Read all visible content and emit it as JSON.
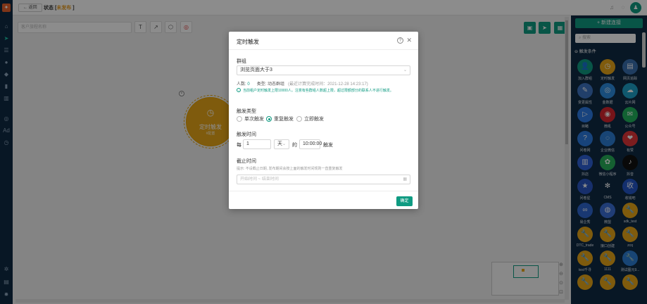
{
  "header": {
    "back_label": "← 返回",
    "status_prefix": "状态 [",
    "status_value": "未发布",
    "status_suffix": " ]"
  },
  "canvas": {
    "name_placeholder": "客户旅程名称",
    "node": {
      "title": "定时触发",
      "subtitle": "#配置"
    }
  },
  "right_panel": {
    "new_connection": "+ 新建连接",
    "search_placeholder": "搜索",
    "section_title": "触发条件",
    "items": [
      {
        "label": "加入群组",
        "color": "#0f9b82",
        "glyph": "👤"
      },
      {
        "label": "定时触发",
        "color": "#e8a619",
        "glyph": "◷"
      },
      {
        "label": "网页追踪",
        "color": "#3a6fb0",
        "glyph": "▤"
      },
      {
        "label": "变更属性",
        "color": "#3c73c2",
        "glyph": "✎"
      },
      {
        "label": "金数据",
        "color": "#2d8de0",
        "glyph": "◎"
      },
      {
        "label": "云片网",
        "color": "#1ea0c8",
        "glyph": "☁"
      },
      {
        "label": "目睹",
        "color": "#2c7be5",
        "glyph": "▷"
      },
      {
        "label": "微吼",
        "color": "#d8262f",
        "glyph": "◉"
      },
      {
        "label": "公众号",
        "color": "#22b35e",
        "glyph": "✉"
      },
      {
        "label": "问卷网",
        "color": "#2a7be0",
        "glyph": "?"
      },
      {
        "label": "企业微信",
        "color": "#2d7fd6",
        "glyph": "◌"
      },
      {
        "label": "有赞",
        "color": "#e2353a",
        "glyph": "❤"
      },
      {
        "label": "抖店",
        "color": "#2f62d8",
        "glyph": "▥"
      },
      {
        "label": "微信小程序",
        "color": "#27b05a",
        "glyph": "✿"
      },
      {
        "label": "抖音",
        "color": "#111111",
        "glyph": "♪"
      },
      {
        "label": "问卷星",
        "color": "#2b56c4",
        "glyph": "★"
      },
      {
        "label": "CMS",
        "color": "#0f2a44",
        "glyph": "✻"
      },
      {
        "label": "收钱吧",
        "color": "#2356c9",
        "glyph": "收"
      },
      {
        "label": "易企秀",
        "color": "#2e66d0",
        "glyph": "∞"
      },
      {
        "label": "微盟",
        "color": "#3b6fd8",
        "glyph": "◍"
      },
      {
        "label": "sdk_test",
        "color": "#e8a619",
        "glyph": "🔧"
      },
      {
        "label": "DTC_trade",
        "color": "#e8a619",
        "glyph": "🔧"
      },
      {
        "label": "接口创建",
        "color": "#e8a619",
        "glyph": "🔧"
      },
      {
        "label": "zcq",
        "color": "#e8a619",
        "glyph": "🔧"
      },
      {
        "label": "test千寻",
        "color": "#e8a619",
        "glyph": "🔧"
      },
      {
        "label": "1111",
        "color": "#e8a619",
        "glyph": "🔧"
      },
      {
        "label": "测试图元9...",
        "color": "#2d7fd6",
        "glyph": "🔧"
      },
      {
        "label": "",
        "color": "#e8a619",
        "glyph": "🔧"
      },
      {
        "label": "",
        "color": "#e8a619",
        "glyph": "🔧"
      },
      {
        "label": "",
        "color": "#e8a619",
        "glyph": "🔧"
      }
    ]
  },
  "modal": {
    "title": "定时触发",
    "group_label": "群组",
    "group_value": "浏览页面大于3",
    "people_label": "人数:",
    "people_value": "0",
    "type_label": "类型:",
    "type_value": "动态群组",
    "last_calc": "(最近计算完成时间：2021-12-28 14:23:17)",
    "tip": "当前租户定时触发上限10000人。注意有些群组人数超上限，超过限额部分的联系人不进行触发。",
    "trigger_type_label": "触发类型",
    "trigger_options": [
      "单次触发",
      "重复触发",
      "立即触发"
    ],
    "trigger_selected": 1,
    "trigger_time_label": "触发时间",
    "every": "每",
    "interval": "1",
    "unit": "天",
    "of": "的",
    "time": "10:00:00",
    "trigger_word": "触发",
    "end_time_label": "截止时间",
    "end_hint": "提示: 不设截止日期, 发布期间会按上面的触发时间规则一直重复触发",
    "range_placeholder": "开始时间 ~ 结束时间",
    "confirm": "确定"
  }
}
